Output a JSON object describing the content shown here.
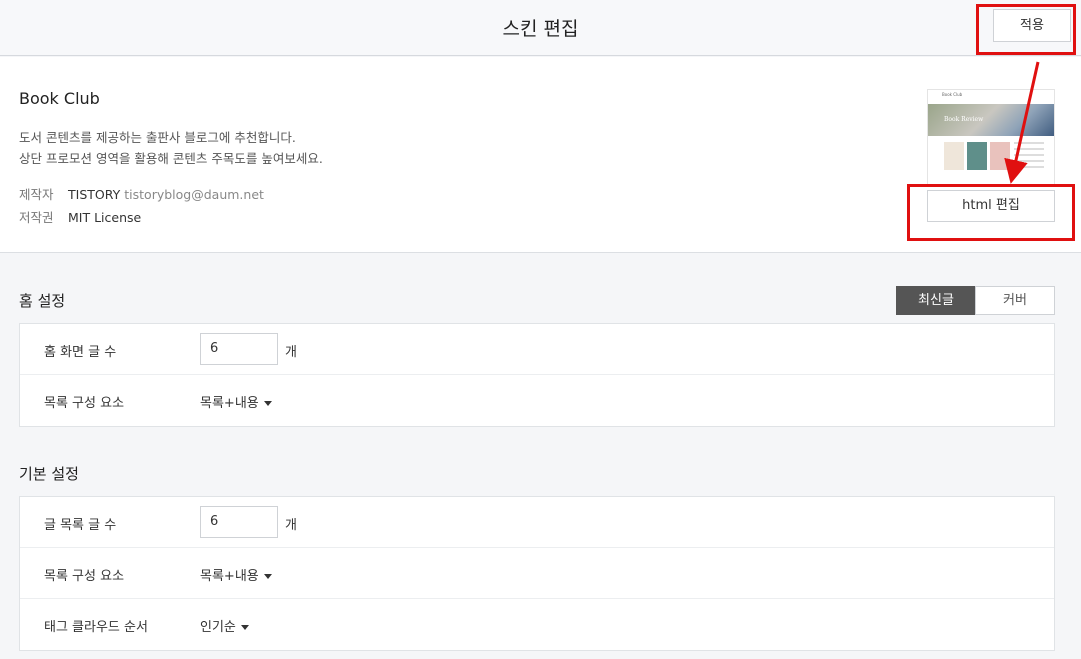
{
  "header": {
    "title": "스킨 편집",
    "apply_label": "적용"
  },
  "skin": {
    "name": "Book Club",
    "description_line1": "도서 콘텐츠를 제공하는 출판사 블로그에 추천합니다.",
    "description_line2": "상단 프로모션 영역을 활용해 콘텐츠 주목도를 높여보세요.",
    "author_label": "제작자",
    "author_name": "TISTORY",
    "author_email": "tistoryblog@daum.net",
    "license_label": "저작권",
    "license_value": "MIT License",
    "thumbnail": {
      "title_text": "Book Club",
      "hero_text": "Book Review"
    },
    "html_edit_label": "html 편집"
  },
  "home_settings": {
    "title": "홈 설정",
    "toggle": {
      "selected": "최신글",
      "other": "커버"
    },
    "rows": [
      {
        "label": "홈 화면 글 수",
        "value": "6",
        "unit": "개"
      },
      {
        "label": "목록 구성 요소",
        "selected": "목록+내용"
      }
    ]
  },
  "basic_settings": {
    "title": "기본 설정",
    "rows": [
      {
        "label": "글 목록 글 수",
        "value": "6",
        "unit": "개"
      },
      {
        "label": "목록 구성 요소",
        "selected": "목록+내용"
      },
      {
        "label": "태그 클라우드 순서",
        "selected": "인기순"
      }
    ]
  },
  "colors": {
    "annotation_red": "#e01010",
    "toggle_active": "#555555"
  }
}
